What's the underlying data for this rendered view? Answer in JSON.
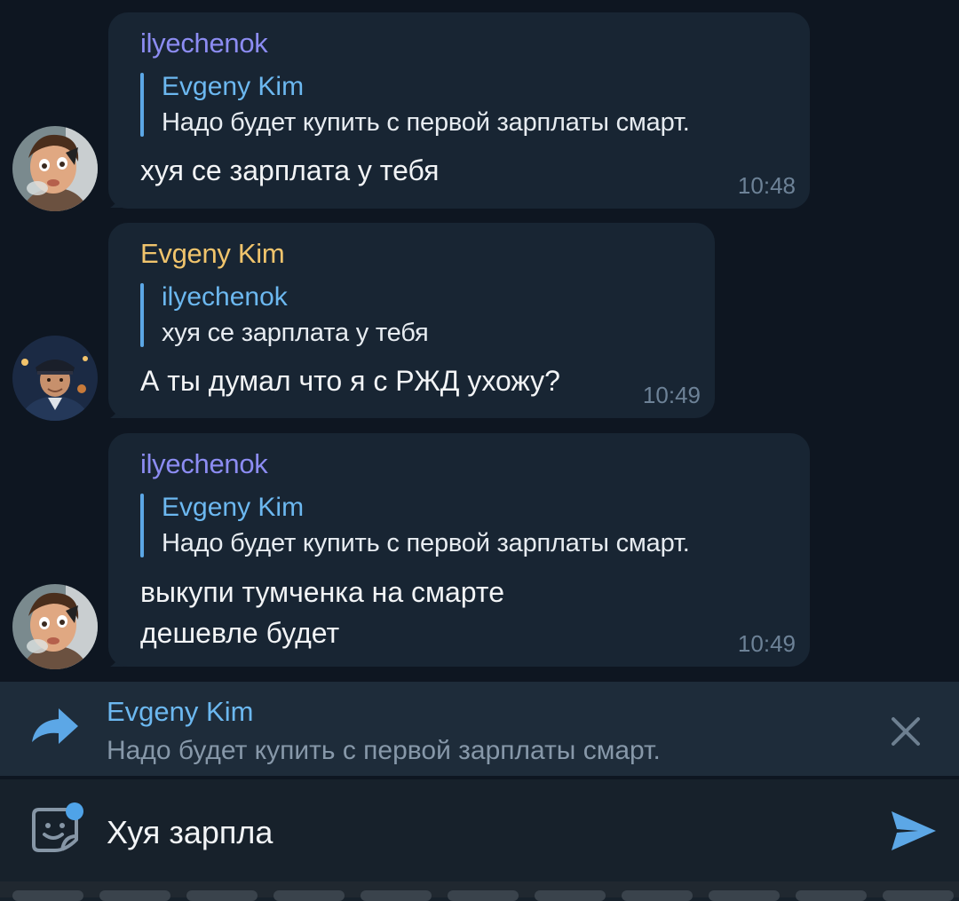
{
  "messages": [
    {
      "sender": "ilyechenok",
      "sender_color": "#8c8cf2",
      "reply_to_name": "Evgeny Kim",
      "reply_to_text": "Надо будет купить с первой зарплаты смарт.",
      "text": "хуя се зарплата у тебя",
      "time": "10:48",
      "avatar_icon": "cartoon-face-avatar"
    },
    {
      "sender": "Evgeny Kim",
      "sender_color": "#f0c46c",
      "reply_to_name": "ilyechenok",
      "reply_to_text": "хуя се зарплата у тебя",
      "text": "А ты думал что я с РЖД ухожу?",
      "time": "10:49",
      "avatar_icon": "train-conductor-avatar"
    },
    {
      "sender": "ilyechenok",
      "sender_color": "#8c8cf2",
      "reply_to_name": "Evgeny Kim",
      "reply_to_text": "Надо будет купить с первой зарплаты смарт.",
      "text": "выкупи тумченка на смарте\nдешевле будет",
      "time": "10:49",
      "avatar_icon": "cartoon-face-avatar"
    }
  ],
  "reply_bar": {
    "name": "Evgeny Kim",
    "text": "Надо будет купить с первой зарплаты смарт.",
    "icon": "reply-arrow-icon",
    "close_icon": "close-icon"
  },
  "composer": {
    "input_value": "Хуя зарпла",
    "sticker_icon": "sticker-icon",
    "send_icon": "send-icon"
  },
  "colors": {
    "chat_bg": "#0e1621",
    "bubble_bg": "#182533",
    "accent": "#5ca7e6",
    "time": "#6d8297"
  }
}
